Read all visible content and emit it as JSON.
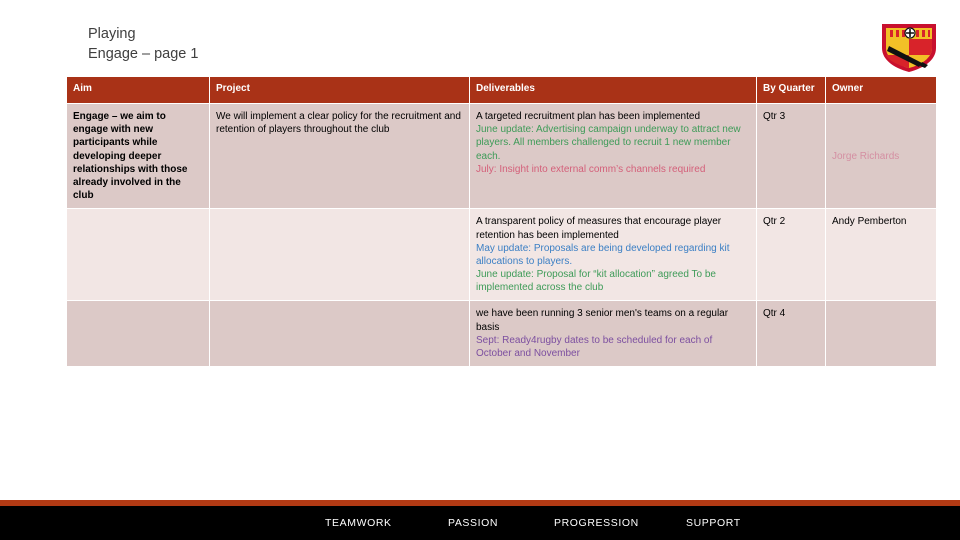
{
  "slide": {
    "title_line_1": "Playing",
    "title_line_2": "Engage – page 1"
  },
  "logo": {
    "name": "club-crest",
    "colors": {
      "shield_border": "#C8102E",
      "gold": "#F2C027",
      "red": "#D8232A",
      "bend": "#111111"
    }
  },
  "table": {
    "headers": [
      "Aim",
      "Project",
      "Deliverables",
      "By Quarter",
      "Owner"
    ],
    "header_bg": "#A93217",
    "rows": [
      {
        "aim": "Engage – we aim to engage with new participants while developing deeper relationships with those already involved in the club",
        "project": "We will implement a clear policy for the recruitment and retention of players throughout the club",
        "deliverables": [
          {
            "text": "A targeted recruitment plan has been implemented",
            "color": "black"
          },
          {
            "text": "June update: Advertising campaign underway to attract new players. All members challenged to recruit 1 new member each.",
            "color": "green"
          },
          {
            "text": "July: Insight into external comm’s channels required",
            "color": "pink"
          }
        ],
        "by_quarter": "Qtr 3",
        "owner": "Jorge Richards",
        "owner_color": "pink",
        "shade": "a"
      },
      {
        "aim": "",
        "project": "",
        "deliverables": [
          {
            "text": "A transparent policy of measures that encourage player retention has been implemented",
            "color": "black"
          },
          {
            "text": "May update: Proposals are being developed regarding kit allocations to players.",
            "color": "blue"
          },
          {
            "text": "June update: Proposal for “kit allocation” agreed  To be implemented across the club",
            "color": "green"
          }
        ],
        "by_quarter": "Qtr 2",
        "owner": "Andy Pemberton",
        "owner_color": "black",
        "shade": "b"
      },
      {
        "aim": "",
        "project": "",
        "deliverables": [
          {
            "text": "we have been running 3 senior men's teams on a regular basis",
            "color": "black"
          },
          {
            "text": "Sept: Ready4rugby dates to be scheduled for each of October and November",
            "color": "purple"
          }
        ],
        "by_quarter": "Qtr 4",
        "owner": "",
        "owner_color": "black",
        "shade": "a"
      }
    ]
  },
  "footer": {
    "values": [
      "TEAMWORK",
      "PASSION",
      "PROGRESSION",
      "SUPPORT"
    ],
    "stripe_color": "#B23A14",
    "bar_color": "#000000"
  }
}
